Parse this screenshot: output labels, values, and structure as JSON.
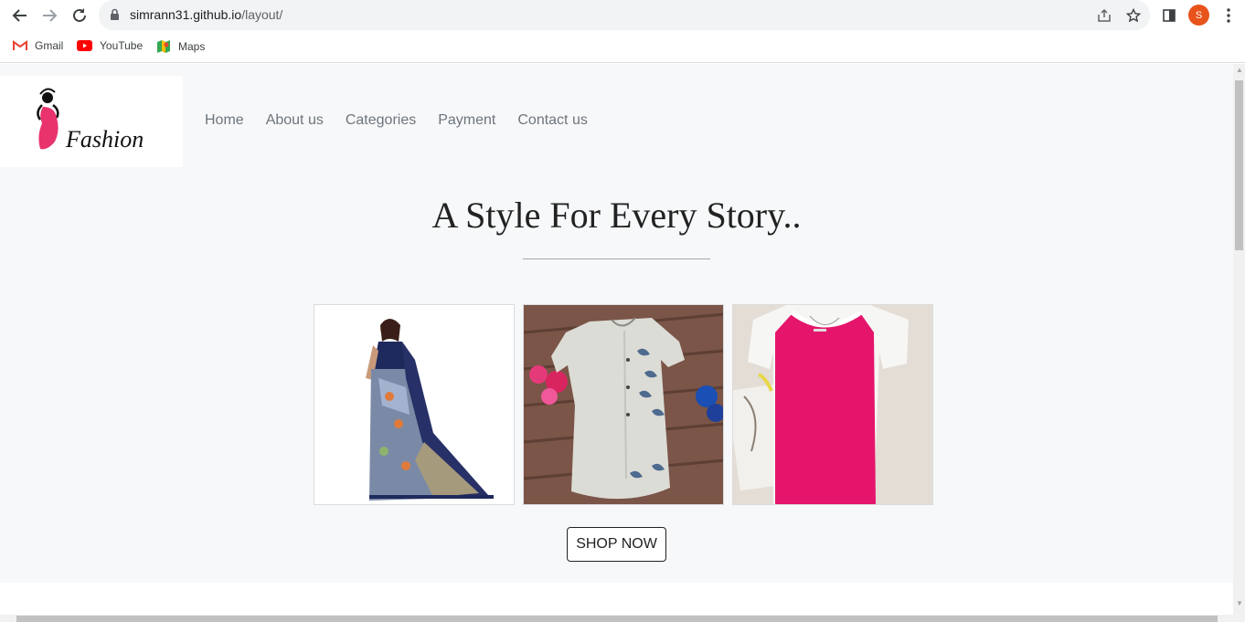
{
  "browser": {
    "url_host": "simrann31.github.io",
    "url_path": "/layout/",
    "avatar_letter": "S",
    "bookmarks": [
      {
        "label": "Gmail",
        "icon": "gmail-icon"
      },
      {
        "label": "YouTube",
        "icon": "youtube-icon"
      },
      {
        "label": "Maps",
        "icon": "maps-icon"
      }
    ]
  },
  "site": {
    "logo_text": "Fashion",
    "nav": [
      "Home",
      "About us",
      "Categories",
      "Payment",
      "Contact us"
    ],
    "headline": "A Style For Every Story..",
    "products": [
      {
        "name": "saree-image"
      },
      {
        "name": "kurti-image"
      },
      {
        "name": "pink-dress-image"
      }
    ],
    "shop_button": "SHOP NOW"
  },
  "colors": {
    "accent_pink": "#e8336d",
    "hero_bg": "#f7f8f9"
  }
}
